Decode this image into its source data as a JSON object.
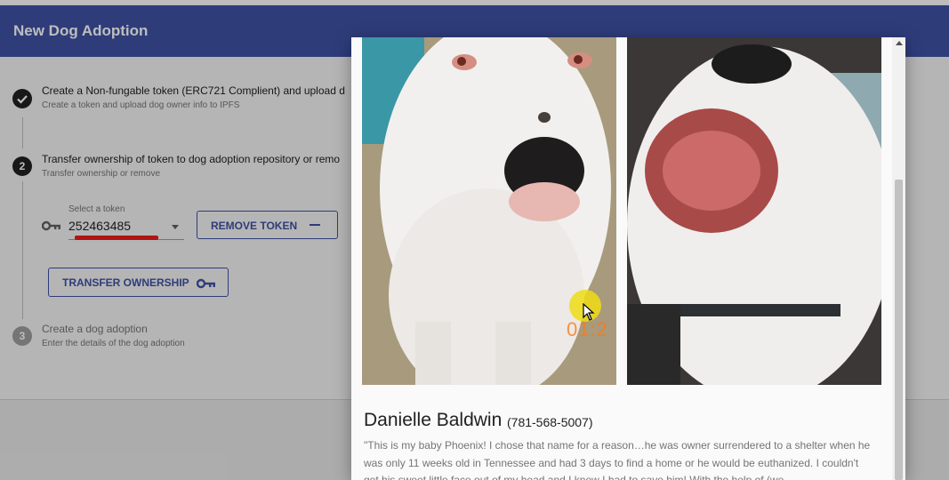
{
  "app": {
    "title": "New Dog Adoption"
  },
  "steps": [
    {
      "number": "✓",
      "title": "Create a Non-fungable token (ERC721 Complient) and upload d",
      "subtitle": "Create a token and upload dog owner info to IPFS",
      "state": "completed"
    },
    {
      "number": "2",
      "title": "Transfer ownership of token to dog adoption repository or remo",
      "subtitle": "Transfer ownership or remove",
      "state": "active"
    },
    {
      "number": "3",
      "title": "Create a dog adoption",
      "subtitle": "Enter the details of the dog adoption",
      "state": "inactive"
    }
  ],
  "token_select": {
    "label": "Select a token",
    "value": "252463485"
  },
  "buttons": {
    "remove_token": "REMOVE TOKEN",
    "transfer_ownership": "TRANSFER OWNERSHIP"
  },
  "modal": {
    "owner_name": "Danielle Baldwin",
    "owner_phone": "(781-568-5007)",
    "story": "\"This is my baby Phoenix! I chose that name for a reason…he was owner surrendered to a shelter when he was only 11 weeks old in Tennessee and had 3 days to find a home or he would be euthanized. I couldn't get his sweet little face out of my head and I knew I had to save him! With the help of (we"
  },
  "overlay": {
    "timestamp": "01:2"
  },
  "colors": {
    "primary": "#3f51a5",
    "annotation_red": "#ee1a1a",
    "cursor_highlight": "#f0dc14"
  },
  "icons": {
    "completed_step": "check-icon",
    "token": "key-icon",
    "remove": "minus-icon",
    "transfer": "key-icon"
  }
}
